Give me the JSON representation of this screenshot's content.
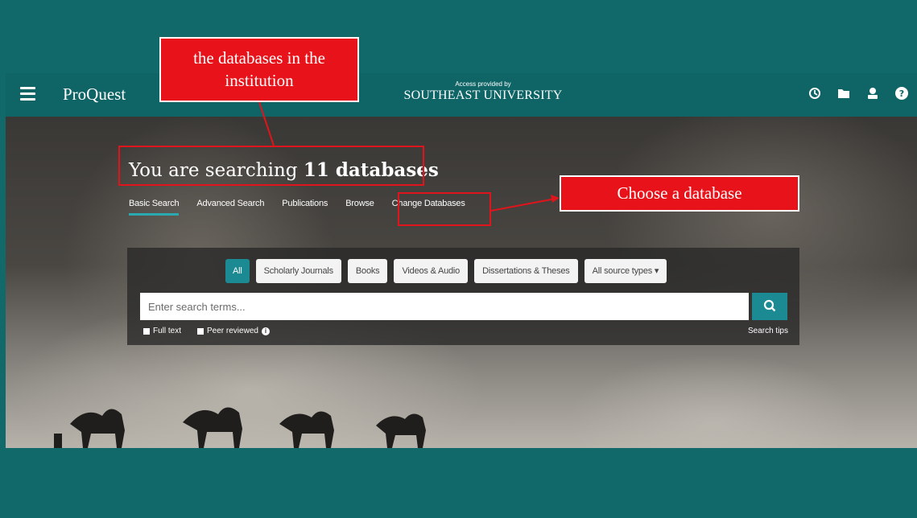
{
  "navbar": {
    "brand": "ProQuest",
    "access_label": "Access provided by",
    "institution": "SOUTHEAST UNIVERSITY"
  },
  "hero": {
    "headline_prefix": "You are searching ",
    "headline_count": "11 databases"
  },
  "tabs": [
    {
      "label": "Basic Search",
      "active": true
    },
    {
      "label": "Advanced Search"
    },
    {
      "label": "Publications"
    },
    {
      "label": "Browse"
    },
    {
      "label": "Change Databases"
    }
  ],
  "source_types": [
    "All",
    "Scholarly Journals",
    "Books",
    "Videos & Audio",
    "Dissertations & Theses",
    "All source types ▾"
  ],
  "search": {
    "placeholder": "Enter search terms...",
    "full_text_label": "Full text",
    "peer_reviewed_label": "Peer reviewed",
    "tips_label": "Search tips"
  },
  "annotations": {
    "databases_note_line1": "the databases in the",
    "databases_note_line2": "institution",
    "choose_note": "Choose a database"
  },
  "colors": {
    "teal": "#12696a",
    "accent": "#1b8a93",
    "annotation_red": "#e8121a"
  }
}
